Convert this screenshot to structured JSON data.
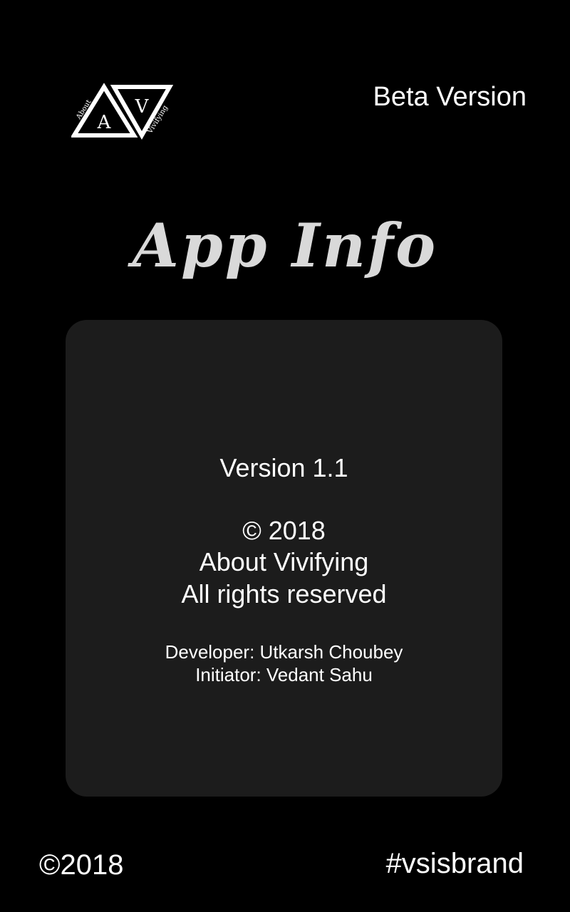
{
  "header": {
    "logo": {
      "left_letter": "A",
      "right_letter": "V",
      "left_word": "About",
      "right_word": "Vivifying"
    },
    "beta_label": "Beta Version"
  },
  "title": "App Info",
  "info_card": {
    "version": "Version 1.1",
    "copyright": "© 2018",
    "company": "About Vivifying",
    "rights": "All rights reserved",
    "developer": "Developer: Utkarsh Choubey",
    "initiator": "Initiator: Vedant Sahu"
  },
  "footer": {
    "copyright": "©2018",
    "hashtag": "#vsisbrand"
  },
  "colors": {
    "background": "#000000",
    "card": "#1c1c1c",
    "text": "#ffffff",
    "title": "#d9d9d9"
  }
}
